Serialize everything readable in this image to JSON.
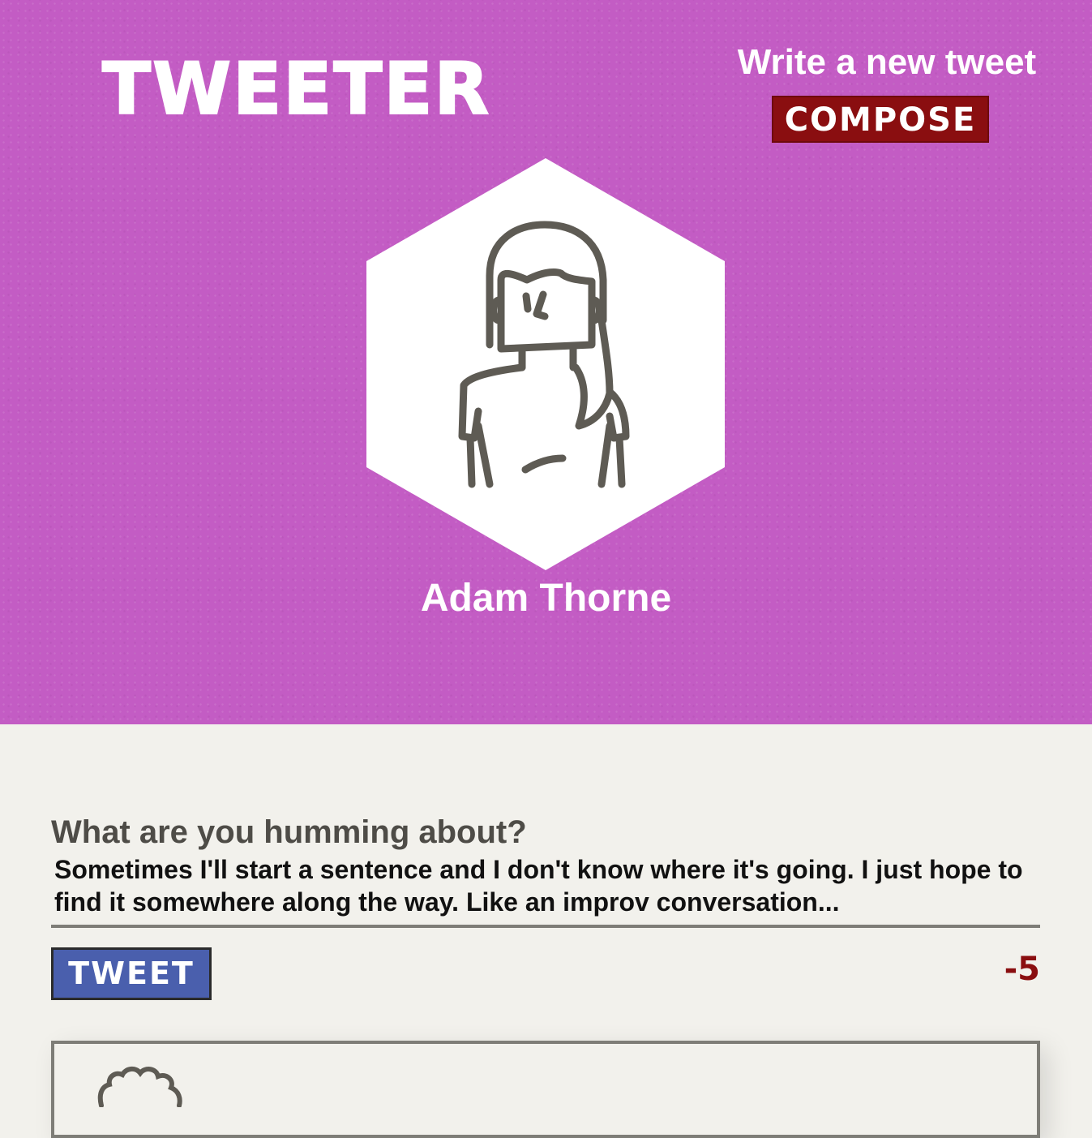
{
  "header": {
    "brand": "TWEETER",
    "compose_hint": "Write a new tweet",
    "compose_label": "COMPOSE",
    "background_color": "#c35cc4"
  },
  "profile": {
    "name": "Adam Thorne",
    "avatar_icon": "user-avatar-icon"
  },
  "composer": {
    "label": "What are you humming about?",
    "value": "Sometimes I'll start a sentence and I don't know where it's going. I just hope to find it somewhere along the way. Like an improv conversation...",
    "tweet_label": "TWEET",
    "char_counter": "-5"
  },
  "colors": {
    "accent_red": "#8a0e10",
    "button_blue": "#4a5fad",
    "page_bg": "#f2f1ec"
  }
}
